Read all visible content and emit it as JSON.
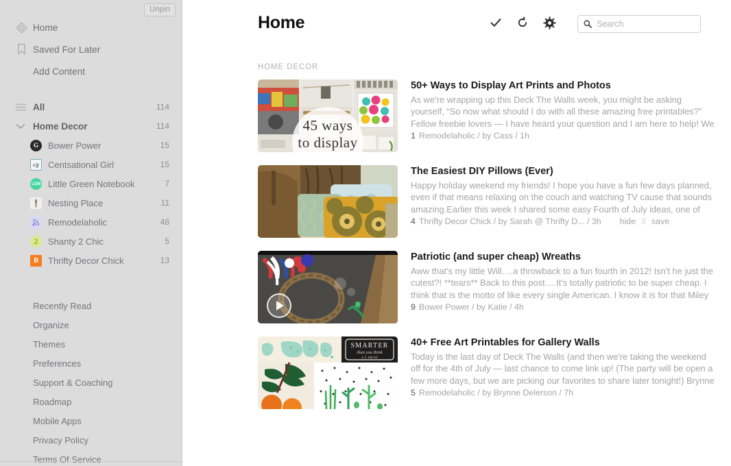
{
  "sidebar": {
    "unpin_label": "Unpin",
    "nav_top": [
      {
        "label": "Home",
        "icon": "home-tag-icon"
      },
      {
        "label": "Saved For Later",
        "icon": "bookmark-icon"
      },
      {
        "label": "Add Content",
        "icon": "none"
      }
    ],
    "groups": [
      {
        "label": "All",
        "count": "114",
        "icon": "hamburger-icon"
      },
      {
        "label": "Home Decor",
        "count": "114",
        "icon": "chevron-down-icon"
      }
    ],
    "feeds": [
      {
        "label": "Bower Power",
        "count": "15",
        "icon_text": "G",
        "icon_class": "ic-bower"
      },
      {
        "label": "Centsational Girl",
        "count": "15",
        "icon_text": "cg",
        "icon_class": "ic-cent"
      },
      {
        "label": "Little Green Notebook",
        "count": "7",
        "icon_text": "LGN",
        "icon_class": "ic-lgn"
      },
      {
        "label": "Nesting Place",
        "count": "11",
        "icon_text": "",
        "icon_class": "ic-nest"
      },
      {
        "label": "Remodelaholic",
        "count": "48",
        "icon_text": "",
        "icon_class": "ic-remod"
      },
      {
        "label": "Shanty 2 Chic",
        "count": "5",
        "icon_text": "2",
        "icon_class": "ic-shant"
      },
      {
        "label": "Thrifty Decor Chick",
        "count": "13",
        "icon_text": "B",
        "icon_class": "ic-thrif"
      }
    ],
    "links": [
      {
        "label": "Recently Read"
      },
      {
        "label": "Organize"
      },
      {
        "label": "Themes"
      },
      {
        "label": "Preferences"
      },
      {
        "label": "Support & Coaching"
      },
      {
        "label": "Roadmap"
      },
      {
        "label": "Mobile Apps"
      },
      {
        "label": "Privacy Policy"
      },
      {
        "label": "Terms Of Service"
      }
    ]
  },
  "header": {
    "title": "Home",
    "tools": [
      {
        "name": "mark-all-read-check-icon"
      },
      {
        "name": "refresh-icon"
      },
      {
        "name": "gear-icon"
      }
    ],
    "search": {
      "placeholder": "Search",
      "value": ""
    }
  },
  "main": {
    "section_label": "HOME DECOR",
    "articles": [
      {
        "title": "50+ Ways to Display Art Prints and Photos",
        "excerpt": "As we're wrapping up this Deck The Walls week, you might be asking yourself, “So now what should I do with all these amazing free printables?” Fellow freebie lovers — I have heard your question and I am here to help! We have",
        "count": "1",
        "byline": "Remodelaholic / by Cass / 1h",
        "thumb": "collage-45-ways-to-display",
        "thumb_caption_line1": "45 ways",
        "thumb_caption_line2": "to display",
        "has_video": false,
        "actions": []
      },
      {
        "title": "The Easiest DIY Pillows (Ever)",
        "excerpt": "Happy holiday weekend my friends! I hope you have a fun few days planned, even if that means relaxing on the couch and watching TV cause that sounds amazing.Earlier this week I shared some easy Fourth of July ideas, one of them",
        "count": "4",
        "byline": "Thrifty Decor Chick / by Sarah @ Thrifty D... / 3h",
        "thumb": "photo-pillows-on-sofa",
        "thumb_caption_line1": "",
        "thumb_caption_line2": "",
        "has_video": false,
        "actions": [
          "hide",
          "//",
          "save"
        ]
      },
      {
        "title": "Patriotic (and super cheap) Wreaths",
        "excerpt": "Aww that's my little Will….a throwback to a fun fourth in 2012!  Isn't he just the cutest?!  **tears** Back to this post….It's totally patriotic to be super cheap.  I think that is the motto of like every single American.  I know it is for that Miley",
        "count": "9",
        "byline": "Bower Power / by Katie / 4h",
        "thumb": "video-patriotic-wreath",
        "thumb_caption_line1": "",
        "thumb_caption_line2": "",
        "has_video": true,
        "actions": []
      },
      {
        "title": "40+ Free Art Printables for Gallery Walls",
        "excerpt": "Today is the last day of Deck The Walls (and then we're taking the weekend off for the 4th of July — last chance to come link up! (The party will be open a few more days, but we are picking our favorites to share later tonight!) Brynne is",
        "count": "5",
        "byline": "Remodelaholic / by Brynne Delerson / 7h",
        "thumb": "collage-art-printables",
        "thumb_caption_line1": "",
        "thumb_caption_line2": "",
        "has_video": false,
        "actions": []
      }
    ]
  },
  "colors": {
    "sidebar_bg": "#dcdcdc",
    "text_muted": "#a5a5a5",
    "title_dark": "#1a1a1a"
  }
}
